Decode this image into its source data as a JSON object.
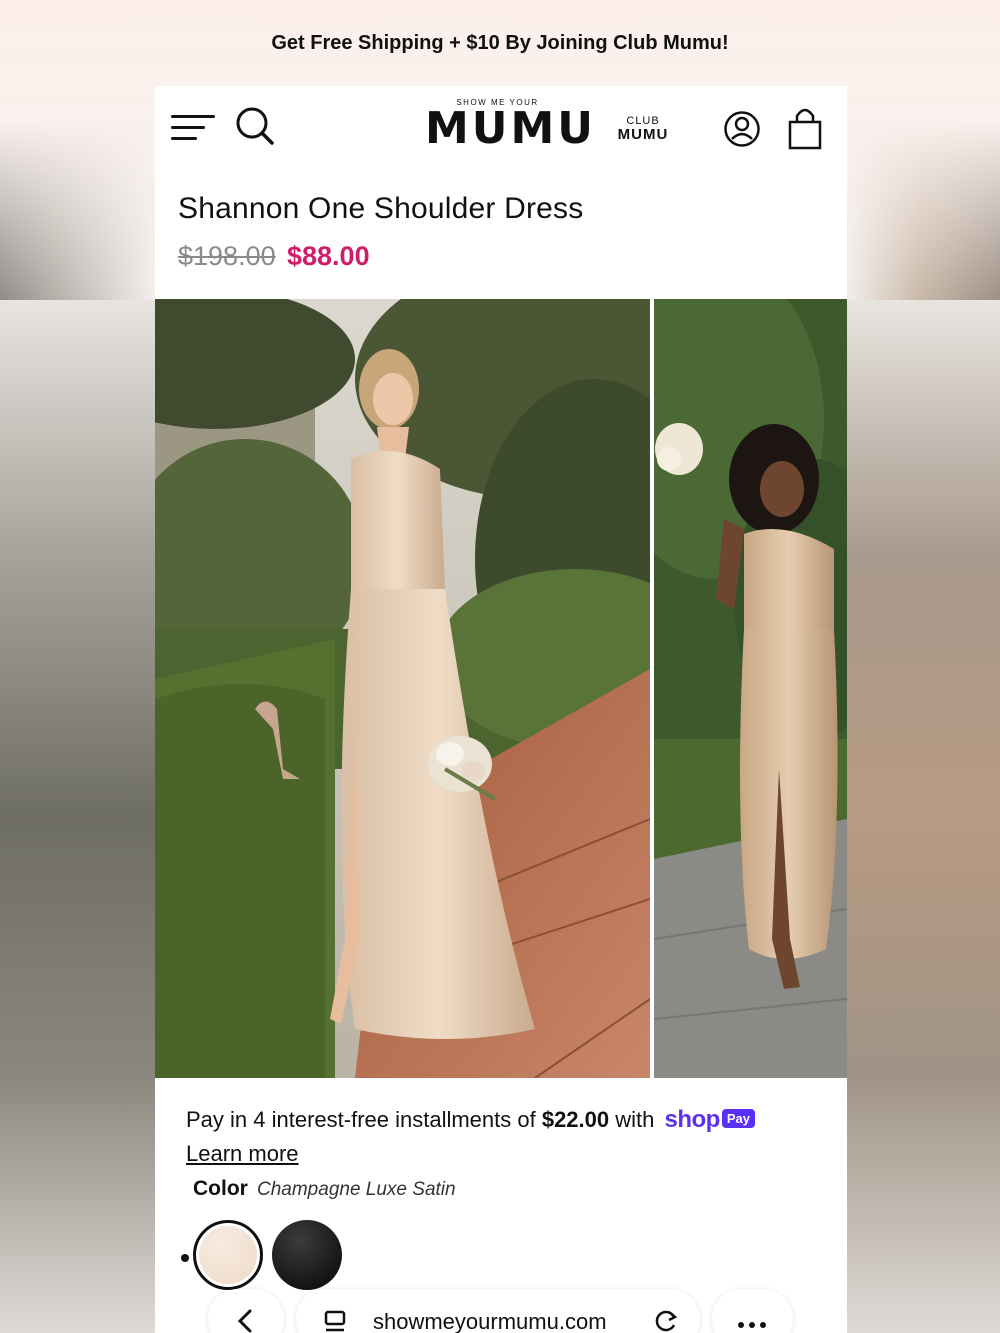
{
  "promo_banner": "Get Free Shipping + $10 By Joining Club Mumu!",
  "header": {
    "logo_small": "SHOW ME YOUR",
    "logo_big": "MUMU",
    "club_top": "CLUB",
    "club_bottom": "MUMU",
    "icons": [
      "menu-icon",
      "search-icon",
      "account-icon",
      "cart-icon"
    ]
  },
  "product": {
    "title": "Shannon One Shoulder Dress",
    "price_original": "$198.00",
    "price_sale": "$88.00",
    "sale_color": "#d01c6b"
  },
  "gallery": {
    "image_count": 6,
    "active_index": 0
  },
  "installments": {
    "text_prefix": "Pay in 4 interest-free installments of ",
    "amount": "$22.00",
    "text_suffix": " with ",
    "provider": "shop",
    "provider_badge": "Pay",
    "learn_more": "Learn more",
    "provider_color": "#5a31f4"
  },
  "color": {
    "label": "Color",
    "selected": "Champagne Luxe Satin",
    "swatches": [
      "champagne",
      "black"
    ]
  },
  "browser": {
    "url": "showmeyourmumu.com",
    "icons": [
      "back-icon",
      "tabs-icon",
      "reload-icon",
      "more-icon"
    ]
  }
}
